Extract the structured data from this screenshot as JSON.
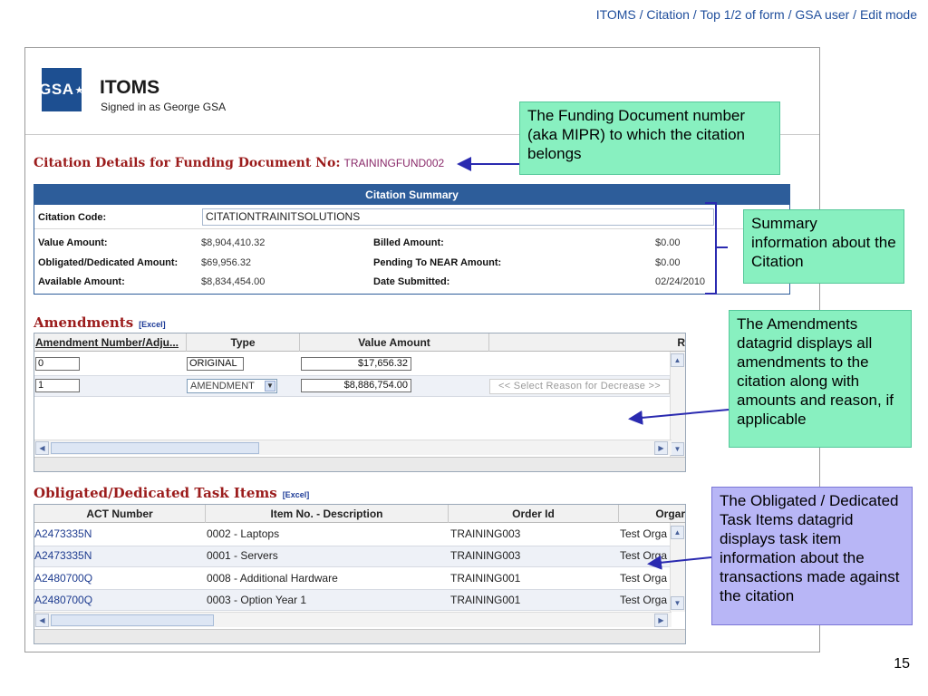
{
  "slide": {
    "header": "ITOMS / Citation / Top 1/2 of form / GSA user / Edit mode",
    "page_number": "15"
  },
  "app": {
    "logo_text": "GSA",
    "title": "ITOMS",
    "signed_in": "Signed in as George GSA"
  },
  "citation": {
    "heading": "Citation Details for Funding Document No:",
    "doc_no": "TRAININGFUND002"
  },
  "summary": {
    "title": "Citation Summary",
    "code_label": "Citation Code:",
    "code_value": "CITATIONTRAINITSOLUTIONS",
    "value_amount_label": "Value Amount:",
    "value_amount": "$8,904,410.32",
    "obligated_label": "Obligated/Dedicated Amount:",
    "obligated": "$69,956.32",
    "available_label": "Available Amount:",
    "available": "$8,834,454.00",
    "billed_label": "Billed Amount:",
    "billed": "$0.00",
    "pending_label": "Pending To NEAR Amount:",
    "pending": "$0.00",
    "date_label": "Date Submitted:",
    "date": "02/24/2010"
  },
  "amendments": {
    "heading": "Amendments",
    "excel": "[Excel]",
    "headers": [
      "Amendment Number/Adju...",
      "Type",
      "Value Amount",
      "R"
    ],
    "rows": [
      {
        "number": "0",
        "type": "ORIGINAL",
        "value": "$17,656.32"
      },
      {
        "number": "1",
        "type": "AMENDMENT",
        "value": "$8,886,754.00",
        "reason": "<< Select Reason for Decrease >>"
      }
    ]
  },
  "task_items": {
    "heading": "Obligated/Dedicated Task Items",
    "excel": "[Excel]",
    "headers": [
      "ACT Number",
      "Item No. - Description",
      "Order Id",
      "Orgar"
    ],
    "rows": [
      {
        "act": "A2473335N",
        "item": "0002 - Laptops",
        "order": "TRAINING003",
        "org": "Test Orga"
      },
      {
        "act": "A2473335N",
        "item": "0001 - Servers",
        "order": "TRAINING003",
        "org": "Test Orga"
      },
      {
        "act": "A2480700Q",
        "item": "0008 - Additional Hardware",
        "order": "TRAINING001",
        "org": "Test Orga"
      },
      {
        "act": "A2480700Q",
        "item": "0003 - Option Year 1",
        "order": "TRAINING001",
        "org": "Test Orga"
      }
    ]
  },
  "callouts": {
    "funding": "The Funding Document number (aka MIPR) to which the citation belongs",
    "summary": "Summary information about the Citation",
    "amendments": "The Amendments datagrid displays all amendments to the citation along with amounts and reason, if applicable",
    "task_items": "The Obligated / Dedicated Task Items datagrid displays task item information about the transactions made against the citation"
  },
  "colors": {
    "accent_blue": "#2d5d9a",
    "section_red": "#9b1c1c",
    "callout_green": "#88f0c0",
    "callout_lavender": "#b8b6f6",
    "arrow_blue": "#2a2ab0"
  }
}
